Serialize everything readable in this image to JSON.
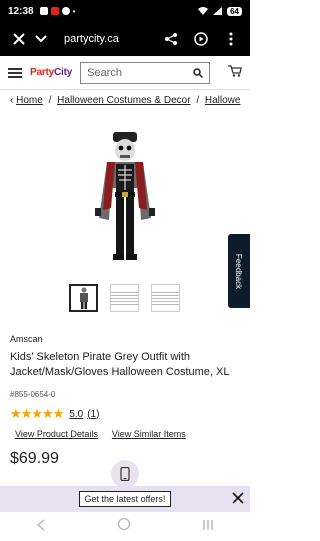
{
  "status": {
    "time": "12:38",
    "battery": "64"
  },
  "browser": {
    "url": "partycity.ca"
  },
  "site": {
    "logo_part1": "Party",
    "logo_part2": "City",
    "search_placeholder": "Search"
  },
  "breadcrumb": [
    "Home",
    "Halloween Costumes & Decor",
    "Hallowe"
  ],
  "product": {
    "brand": "Amscan",
    "title": "Kids' Skeleton Pirate Grey Outfit with Jacket/Mask/Gloves Halloween Costume, XL",
    "sku": "#855-0654-0",
    "rating_value": "5.0",
    "rating_count": "(1)",
    "view_details": "View Product Details",
    "view_similar": "View Similar Items",
    "price": "$69.99"
  },
  "feedback_label": "Feedback",
  "banner": {
    "cta": "Get the latest offers!"
  },
  "icons": {
    "close": "close-icon",
    "chevron": "chevron-down-icon",
    "share": "share-icon",
    "play": "play-icon",
    "menu": "more-vert-icon",
    "search": "search-icon",
    "cart": "cart-icon",
    "phone": "phone-icon"
  },
  "colors": {
    "brand_red": "#e2231a",
    "brand_purple": "#5b2c86",
    "star": "#f2a400",
    "banner": "#e6e1f0"
  }
}
